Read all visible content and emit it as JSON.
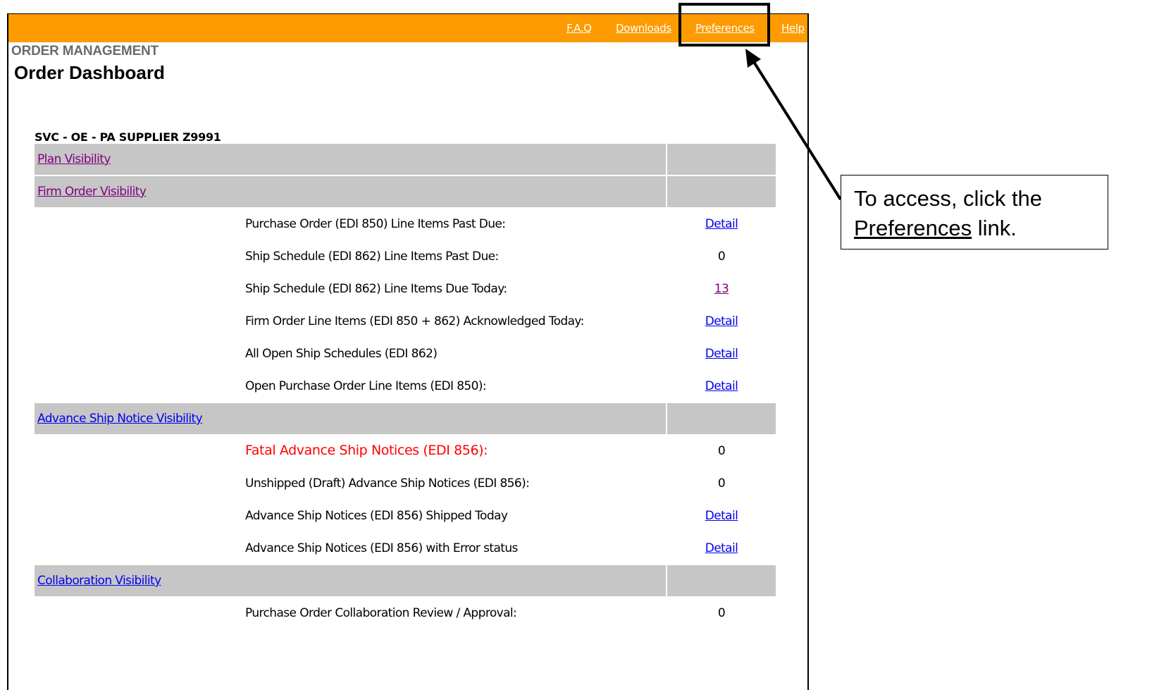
{
  "nav": {
    "links": {
      "faq": "F.A.Q",
      "downloads": "Downloads",
      "preferences": "Preferences",
      "help": "Help"
    },
    "bar_color": "#fd9b00"
  },
  "header": {
    "section": "ORDER MANAGEMENT",
    "title": "Order Dashboard"
  },
  "supplier": "SVC - OE - PA SUPPLIER Z9991",
  "sections": {
    "plan": {
      "label": "Plan Visibility"
    },
    "firm": {
      "label": "Firm Order Visibility",
      "rows": [
        {
          "label": "Purchase Order (EDI 850) Line Items Past Due:",
          "value": "Detail"
        },
        {
          "label": "Ship Schedule (EDI 862) Line Items Past Due:",
          "value": "0"
        },
        {
          "label": "Ship Schedule (EDI 862) Line Items Due Today:",
          "value": "13"
        },
        {
          "label": "Firm Order Line Items (EDI 850 + 862) Acknowledged Today:",
          "value": "Detail"
        },
        {
          "label": "All Open Ship Schedules (EDI 862)",
          "value": "Detail"
        },
        {
          "label": "Open Purchase Order Line Items (EDI 850):",
          "value": "Detail"
        }
      ]
    },
    "asn": {
      "label": "Advance Ship Notice Visibility",
      "rows": [
        {
          "label": "Fatal Advance Ship Notices (EDI 856):",
          "value": "0"
        },
        {
          "label": "Unshipped (Draft) Advance Ship Notices (EDI 856):",
          "value": "0"
        },
        {
          "label": "Advance Ship Notices (EDI 856) Shipped Today",
          "value": "Detail"
        },
        {
          "label": "Advance Ship Notices (EDI 856) with Error status",
          "value": "Detail"
        }
      ]
    },
    "collab": {
      "label": "Collaboration Visibility",
      "rows": [
        {
          "label": "Purchase Order Collaboration Review / Approval:",
          "value": "0"
        }
      ]
    }
  },
  "callout": {
    "text_before": "To access, click the",
    "link_text": "Preferences",
    "text_after": " link."
  }
}
